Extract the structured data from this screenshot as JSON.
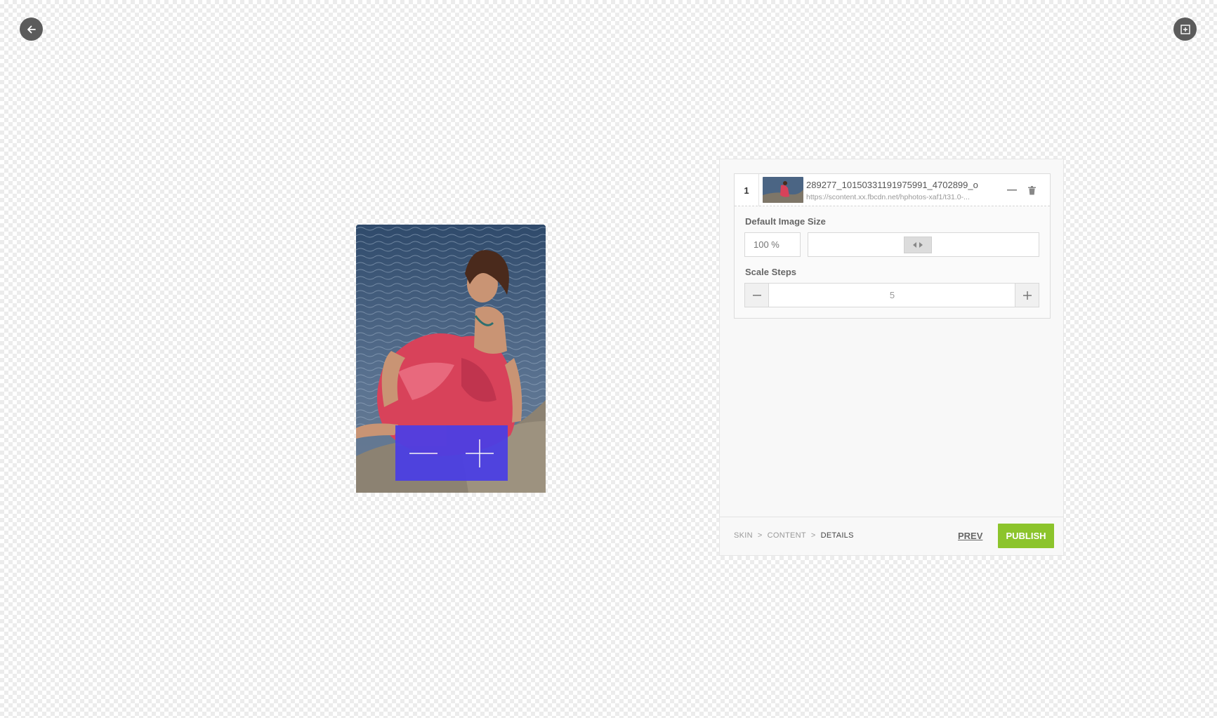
{
  "toolbar": {
    "back_icon": "arrow-left-icon",
    "frame_icon": "frame-plus-icon"
  },
  "preview": {
    "zoom_out_icon": "minus-icon",
    "zoom_in_icon": "plus-icon",
    "accent_color": "#4a3ee6"
  },
  "item": {
    "index": "1",
    "title": "289277_10150331191975991_4702899_o",
    "url": "https://scontent.xx.fbcdn.net/hphotos-xaf1/t31.0-..."
  },
  "settings": {
    "default_image_size_label": "Default Image Size",
    "default_image_size_placeholder": "100 %",
    "scale_steps_label": "Scale Steps",
    "scale_steps_value": "5"
  },
  "footer": {
    "breadcrumb": [
      "SKIN",
      "CONTENT",
      "DETAILS"
    ],
    "separator": ">",
    "prev_label": "PREV",
    "publish_label": "PUBLISH",
    "publish_color": "#8cc42c"
  }
}
